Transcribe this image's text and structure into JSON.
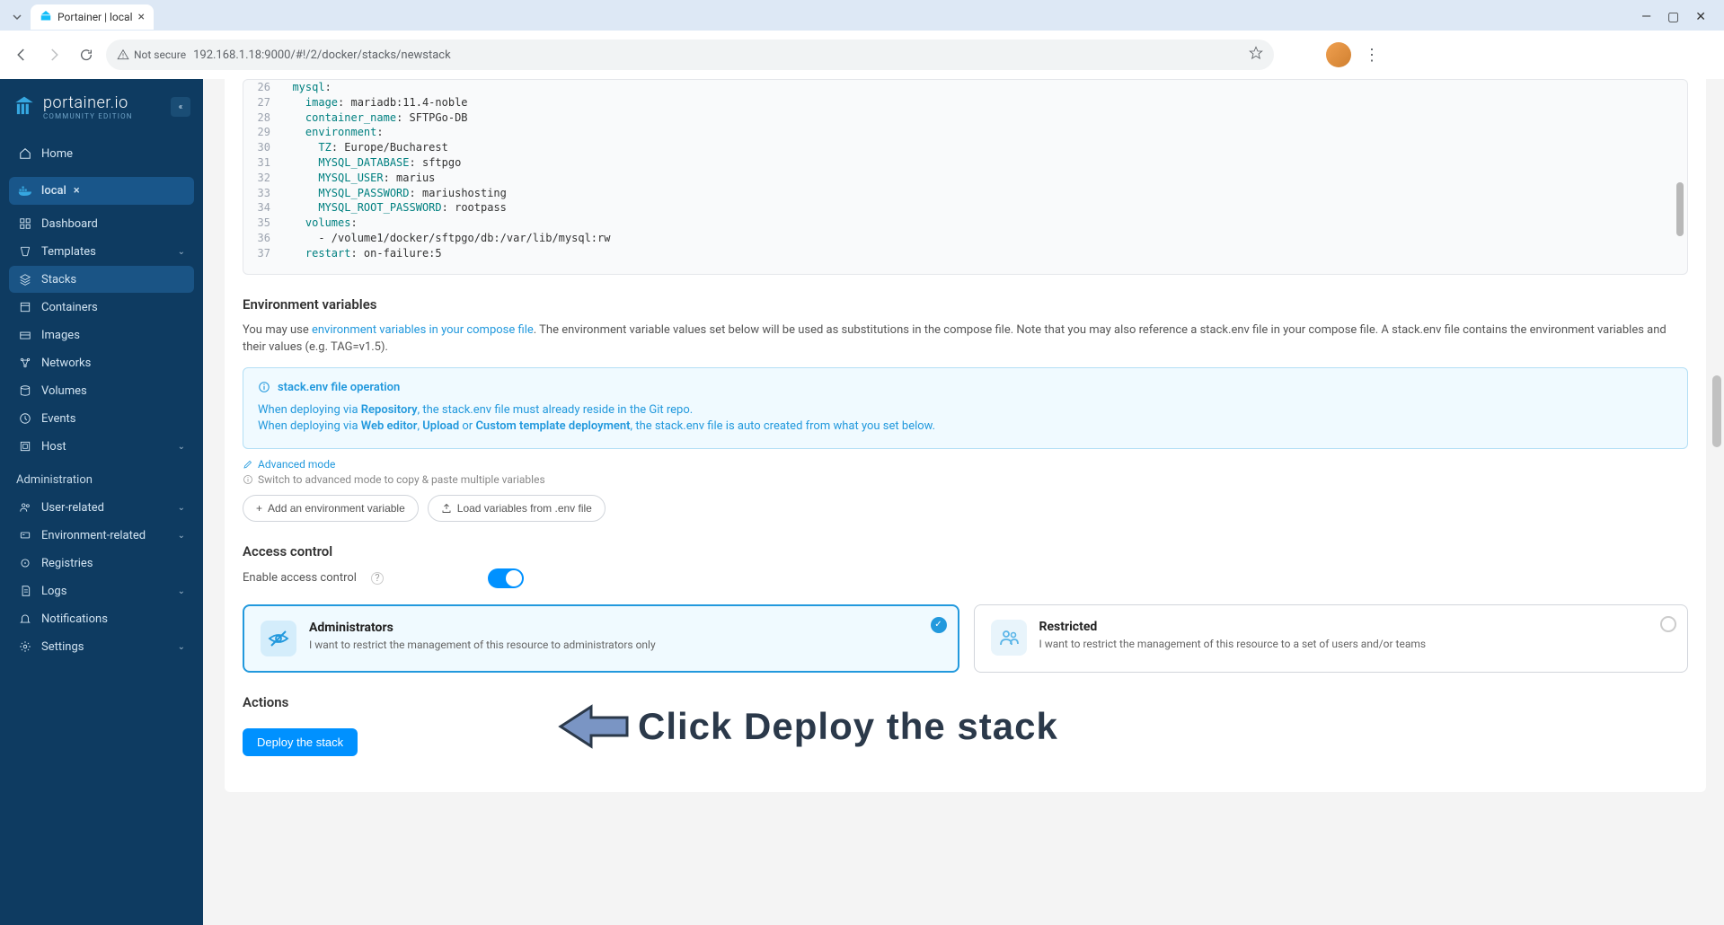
{
  "browser": {
    "tab_title": "Portainer | local",
    "not_secure_label": "Not secure",
    "url": "192.168.1.18:9000/#!/2/docker/stacks/newstack"
  },
  "sidebar": {
    "brand": "portainer.io",
    "edition": "COMMUNITY EDITION",
    "home": "Home",
    "env_name": "local",
    "items": [
      {
        "label": "Dashboard"
      },
      {
        "label": "Templates"
      },
      {
        "label": "Stacks"
      },
      {
        "label": "Containers"
      },
      {
        "label": "Images"
      },
      {
        "label": "Networks"
      },
      {
        "label": "Volumes"
      },
      {
        "label": "Events"
      },
      {
        "label": "Host"
      }
    ],
    "admin_label": "Administration",
    "admin_items": [
      {
        "label": "User-related"
      },
      {
        "label": "Environment-related"
      },
      {
        "label": "Registries"
      },
      {
        "label": "Logs"
      },
      {
        "label": "Notifications"
      },
      {
        "label": "Settings"
      }
    ]
  },
  "editor": {
    "lines": [
      {
        "n": 26,
        "indent": "  ",
        "key": "mysql",
        "val": ":"
      },
      {
        "n": 27,
        "indent": "    ",
        "key": "image",
        "val": ": mariadb:11.4-noble"
      },
      {
        "n": 28,
        "indent": "    ",
        "key": "container_name",
        "val": ": SFTPGo-DB"
      },
      {
        "n": 29,
        "indent": "    ",
        "key": "environment",
        "val": ":"
      },
      {
        "n": 30,
        "indent": "      ",
        "key": "TZ",
        "val": ": Europe/Bucharest"
      },
      {
        "n": 31,
        "indent": "      ",
        "key": "MYSQL_DATABASE",
        "val": ": sftpgo"
      },
      {
        "n": 32,
        "indent": "      ",
        "key": "MYSQL_USER",
        "val": ": marius"
      },
      {
        "n": 33,
        "indent": "      ",
        "key": "MYSQL_PASSWORD",
        "val": ": mariushosting"
      },
      {
        "n": 34,
        "indent": "      ",
        "key": "MYSQL_ROOT_PASSWORD",
        "val": ": rootpass"
      },
      {
        "n": 35,
        "indent": "    ",
        "key": "volumes",
        "val": ":"
      },
      {
        "n": 36,
        "indent": "      ",
        "key": "",
        "val": "- /volume1/docker/sftpgo/db:/var/lib/mysql:rw"
      },
      {
        "n": 37,
        "indent": "    ",
        "key": "restart",
        "val": ": on-failure:5"
      }
    ]
  },
  "env_section": {
    "title": "Environment variables",
    "desc_prefix": "You may use ",
    "desc_link": "environment variables in your compose file",
    "desc_suffix": ". The environment variable values set below will be used as substitutions in the compose file. Note that you may also reference a stack.env file in your compose file. A stack.env file contains the environment variables and their values (e.g. TAG=v1.5).",
    "info_title": "stack.env file operation",
    "info_line1_prefix": "When deploying via ",
    "info_line1_bold": "Repository",
    "info_line1_suffix": ", the stack.env file must already reside in the Git repo.",
    "info_line2_prefix": "When deploying via ",
    "info_line2_b1": "Web editor",
    "info_line2_s1": ", ",
    "info_line2_b2": "Upload",
    "info_line2_s2": " or ",
    "info_line2_b3": "Custom template deployment",
    "info_line2_suffix": ", the stack.env file is auto created from what you set below.",
    "advanced_mode": "Advanced mode",
    "advanced_hint": "Switch to advanced mode to copy & paste multiple variables",
    "add_var_btn": "Add an environment variable",
    "load_env_btn": "Load variables from .env file"
  },
  "access": {
    "title": "Access control",
    "enable_label": "Enable access control",
    "admin_title": "Administrators",
    "admin_desc": "I want to restrict the management of this resource to administrators only",
    "restricted_title": "Restricted",
    "restricted_desc": "I want to restrict the management of this resource to a set of users and/or teams"
  },
  "actions": {
    "title": "Actions",
    "deploy_btn": "Deploy the stack"
  },
  "annotation": {
    "text": "Click Deploy the stack"
  }
}
